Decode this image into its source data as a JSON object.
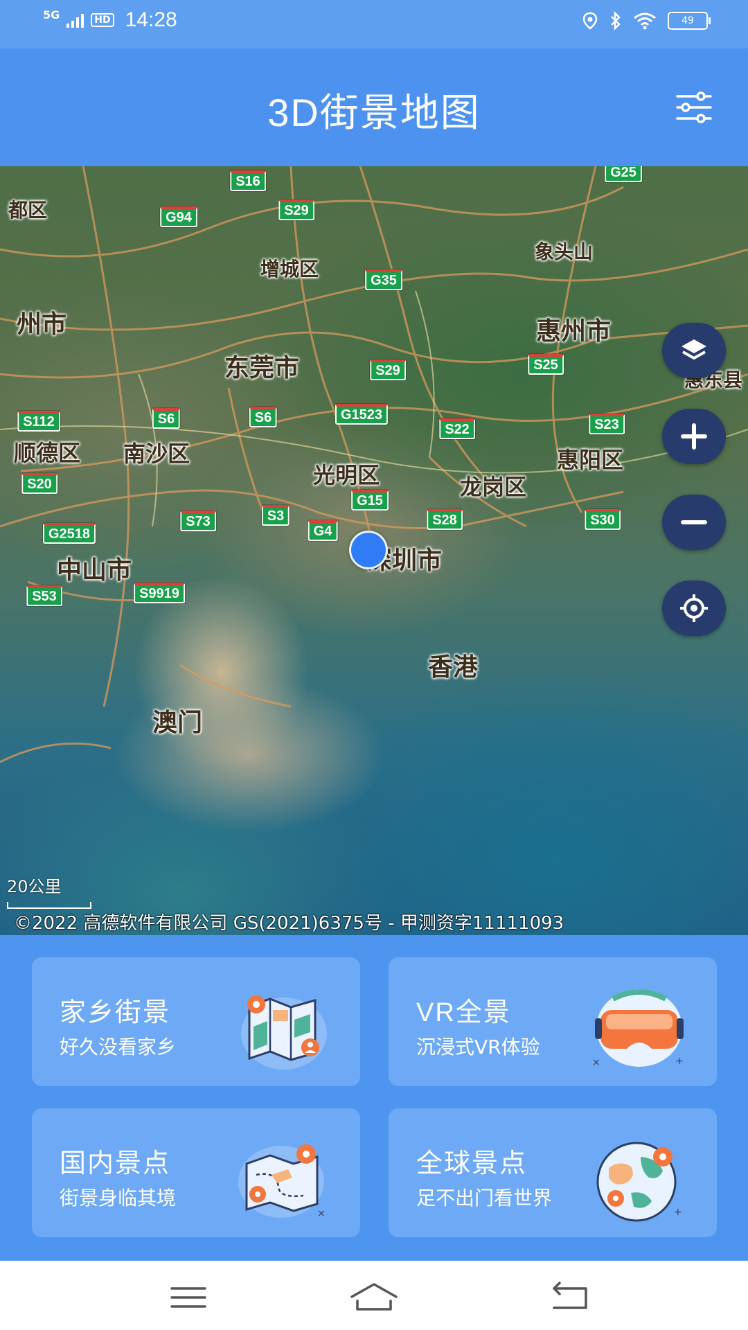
{
  "status_bar": {
    "network": "5G",
    "hd": "HD",
    "time": "14:28",
    "battery": "49"
  },
  "header": {
    "title": "3D街景地图",
    "settings_icon": "sliders-icon"
  },
  "map": {
    "place_labels": [
      "都区",
      "增城区",
      "象头山",
      "州市",
      "惠州市",
      "东莞市",
      "惠东县",
      "顺德区",
      "南沙区",
      "光明区",
      "龙岗区",
      "惠阳区",
      "中山市",
      "深圳市",
      "香港",
      "澳门"
    ],
    "road_shields": [
      "S16",
      "G25",
      "G94",
      "S29",
      "G35",
      "S29",
      "S25",
      "S112",
      "S6",
      "S6",
      "G1523",
      "S22",
      "S23",
      "S20",
      "G15",
      "S73",
      "S3",
      "G4",
      "S28",
      "S30",
      "G2518",
      "S53",
      "S9919"
    ],
    "scale": "20公里",
    "copyright": "©2022 高德软件有限公司 GS(2021)6375号 - 甲测资字11111093",
    "controls": {
      "layers_icon": "layers-icon",
      "zoom_in_icon": "plus-icon",
      "zoom_out_icon": "minus-icon",
      "locate_icon": "locate-icon"
    }
  },
  "cards": [
    {
      "title": "家乡街景",
      "subtitle": "好久没看家乡",
      "icon": "hometown-map-icon"
    },
    {
      "title": "VR全景",
      "subtitle": "沉浸式VR体验",
      "icon": "vr-headset-icon"
    },
    {
      "title": "国内景点",
      "subtitle": "街景身临其境",
      "icon": "domestic-map-icon"
    },
    {
      "title": "全球景点",
      "subtitle": "足不出门看世界",
      "icon": "globe-pin-icon"
    }
  ],
  "nav": {
    "menu_icon": "menu-icon",
    "home_icon": "home-icon",
    "back_icon": "back-icon"
  }
}
